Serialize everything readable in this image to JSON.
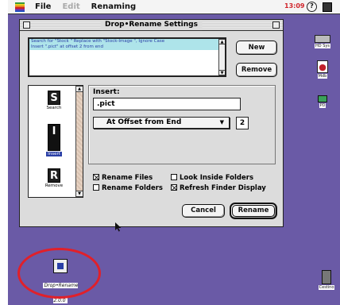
{
  "menubar": {
    "menus": [
      "File",
      "Edit",
      "Renaming"
    ],
    "clock": "13:09",
    "help": "?"
  },
  "window": {
    "title": "Drop•Rename Settings",
    "rules": [
      "Search for \"Stock \" Replace with \"Stock-Image \", Ignore Case",
      "Insert \".pict\" at offset 2 from end"
    ],
    "new_label": "New",
    "remove_label": "Remove"
  },
  "sidebar": {
    "tools": [
      {
        "glyph": "S",
        "label": "Search",
        "icon": "search-tool-icon"
      },
      {
        "glyph": "I",
        "label": "Insert",
        "icon": "insert-tool-icon"
      },
      {
        "glyph": "R",
        "label": "Remove",
        "icon": "remove-tool-icon"
      }
    ]
  },
  "insert_panel": {
    "label": "Insert:",
    "text_value": ".pict",
    "position_option": "At Offset from End",
    "offset_value": "2"
  },
  "options": {
    "rename_files": {
      "label": "Rename Files",
      "checked": true
    },
    "look_inside": {
      "label": "Look Inside Folders",
      "checked": false
    },
    "rename_folders": {
      "label": "Rename Folders",
      "checked": false
    },
    "refresh_finder": {
      "label": "Refresh Finder Display",
      "checked": true
    }
  },
  "buttons": {
    "cancel": "Cancel",
    "rename": "Rename"
  },
  "desktop": {
    "hd_label": "HD Sys",
    "mdb_label": "Mdb",
    "pd_label": "PD",
    "trash_label": "Cestino",
    "app_label": "Drop•Rename 2.0.0"
  },
  "colors": {
    "desktop": "#6a5aa6",
    "selection": "#aee4ea",
    "highlight_ellipse": "#e0202a",
    "clock": "#d0242b"
  }
}
